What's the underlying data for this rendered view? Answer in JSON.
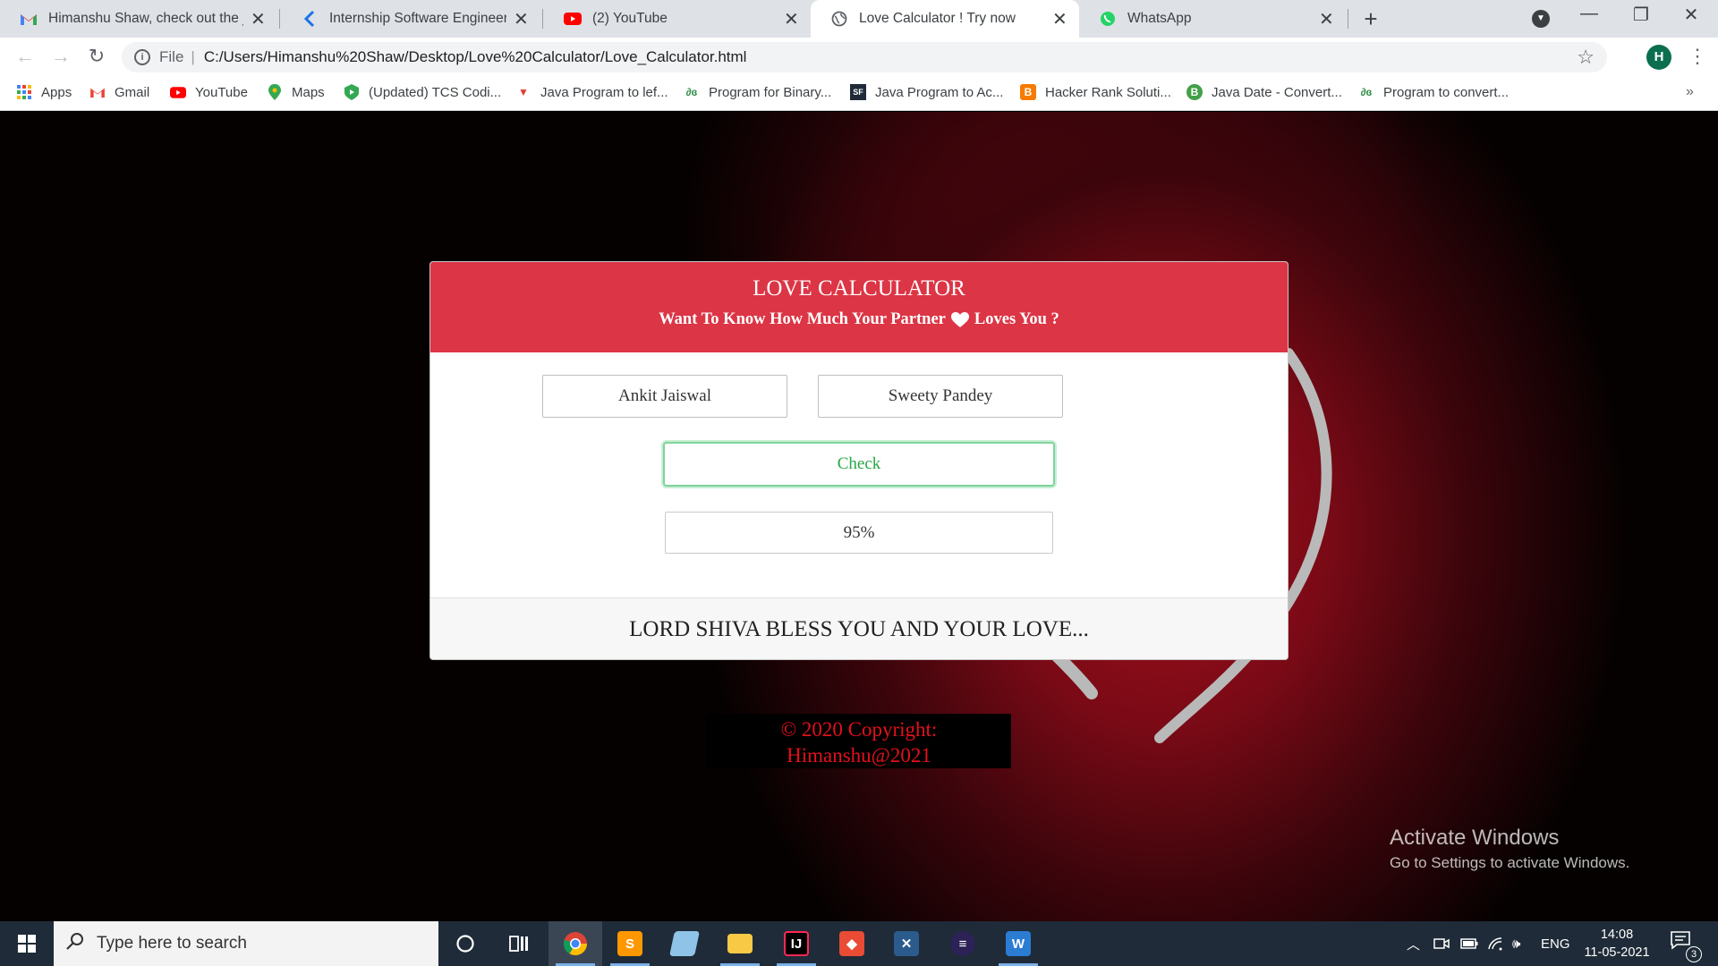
{
  "browser": {
    "tabs": [
      {
        "title": "Himanshu Shaw, check out the jo",
        "icon": "gmail-icon",
        "active": false
      },
      {
        "title": "Internship Software Engineering",
        "icon": "kaggle-icon",
        "active": false
      },
      {
        "title": "(2) YouTube",
        "icon": "youtube-icon",
        "active": false
      },
      {
        "title": "Love Calculator ! Try now",
        "icon": "globe-icon",
        "active": true
      },
      {
        "title": "WhatsApp",
        "icon": "whatsapp-icon",
        "active": false
      }
    ],
    "omnibox": {
      "scheme_label": "File",
      "url": "C:/Users/Himanshu%20Shaw/Desktop/Love%20Calculator/Love_Calculator.html"
    },
    "profile_initial": "H",
    "bookmarks": [
      {
        "label": "Apps",
        "icon": "apps-grid-icon"
      },
      {
        "label": "Gmail",
        "icon": "gmail-icon"
      },
      {
        "label": "YouTube",
        "icon": "youtube-icon"
      },
      {
        "label": "Maps",
        "icon": "maps-pin-icon"
      },
      {
        "label": "(Updated) TCS Codi...",
        "icon": "green-shield-icon"
      },
      {
        "label": "Java Program to lef...",
        "icon": "red-v-icon"
      },
      {
        "label": "Program for Binary...",
        "icon": "gfg-icon"
      },
      {
        "label": "Java Program to Ac...",
        "icon": "sf-icon"
      },
      {
        "label": "Hacker Rank Soluti...",
        "icon": "blogger-icon"
      },
      {
        "label": "Java Date - Convert...",
        "icon": "green-b-icon"
      },
      {
        "label": "Program to convert...",
        "icon": "gfg-icon"
      }
    ]
  },
  "page": {
    "title": "LOVE CALCULATOR",
    "subtitle_before": "Want To Know How Much Your Partner",
    "subtitle_after": "Loves You ?",
    "name1": "Ankit Jaiswal",
    "plus": "+",
    "name2": "Sweety Pandey",
    "check_label": "Check",
    "result": "95%",
    "footer": "LORD SHIVA BLESS YOU AND YOUR LOVE...",
    "copyright_line1": "© 2020 Copyright:",
    "copyright_line2": "Himanshu@2021",
    "colors": {
      "header": "#dc3545",
      "check": "#28a745",
      "copyright": "#e3101c"
    }
  },
  "watermark": {
    "line1": "Activate Windows",
    "line2": "Go to Settings to activate Windows."
  },
  "taskbar": {
    "search_placeholder": "Type here to search",
    "apps": [
      "cortana-icon",
      "task-view-icon",
      "chrome-icon",
      "sublime-icon",
      "notepad-icon",
      "file-explorer-icon",
      "intellij-icon",
      "git-icon",
      "netbeans-icon",
      "eclipse-icon",
      "word-icon"
    ],
    "language": "ENG",
    "time": "14:08",
    "date": "11-05-2021",
    "notification_count": "3"
  }
}
